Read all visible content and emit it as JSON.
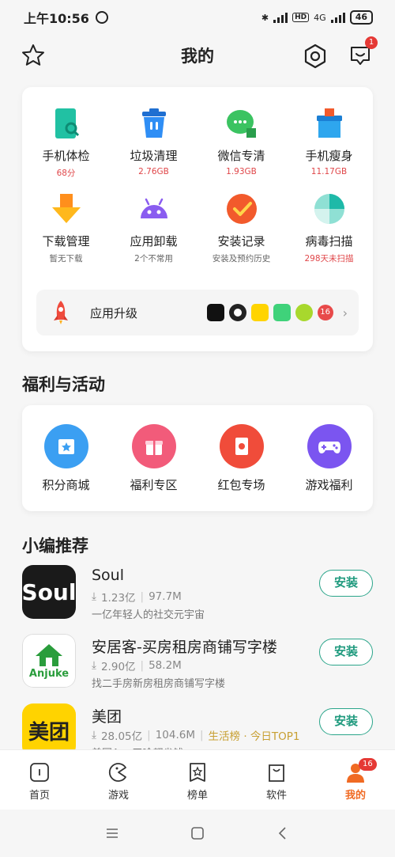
{
  "status_bar": {
    "time": "上午10:56",
    "network": "4G",
    "battery": "46"
  },
  "header": {
    "title": "我的",
    "msg_badge": "1"
  },
  "tools": [
    {
      "label": "手机体检",
      "sub": "68分",
      "sub_style": "red",
      "icon": "phone-scan-icon",
      "color": "#21c1a3"
    },
    {
      "label": "垃圾清理",
      "sub": "2.76GB",
      "sub_style": "red",
      "icon": "trash-icon",
      "color": "#2f8ef5"
    },
    {
      "label": "微信专清",
      "sub": "1.93GB",
      "sub_style": "red",
      "icon": "wechat-clean-icon",
      "color": "#3bc361"
    },
    {
      "label": "手机瘦身",
      "sub": "11.17GB",
      "sub_style": "red",
      "icon": "slim-box-icon",
      "color": "#2ea6ee"
    },
    {
      "label": "下载管理",
      "sub": "暂无下载",
      "sub_style": "gray",
      "icon": "download-arrow-icon",
      "color": "#ffb81c"
    },
    {
      "label": "应用卸载",
      "sub": "2个不常用",
      "sub_style": "gray",
      "icon": "android-icon",
      "color": "#8a5cf0"
    },
    {
      "label": "安装记录",
      "sub": "安装及预约历史",
      "sub_style": "gray",
      "icon": "check-circle-icon",
      "color": "#f25a2c"
    },
    {
      "label": "病毒扫描",
      "sub": "298天未扫描",
      "sub_style": "red",
      "icon": "virus-scan-icon",
      "color": "#1eb9a8"
    }
  ],
  "upgrade": {
    "label": "应用升级",
    "count": "16",
    "app_icons": [
      "tiktok-icon",
      "qq-icon",
      "xianyu-icon",
      "video-icon",
      "browser-icon"
    ]
  },
  "welfare": {
    "title": "福利与活动",
    "items": [
      {
        "label": "积分商城",
        "icon": "points-mall-icon",
        "color": "#3b9ff2"
      },
      {
        "label": "福利专区",
        "icon": "gift-icon",
        "color": "#f25b7a"
      },
      {
        "label": "红包专场",
        "icon": "red-packet-icon",
        "color": "#f04c3a"
      },
      {
        "label": "游戏福利",
        "icon": "gamepad-icon",
        "color": "#7b55f0"
      }
    ]
  },
  "recommend": {
    "title": "小编推荐",
    "apps": [
      {
        "name": "Soul",
        "downloads": "1.23亿",
        "size": "97.7M",
        "rank": "",
        "desc": "一亿年轻人的社交元宇宙",
        "install": "安装",
        "logo_text": "Soul"
      },
      {
        "name": "安居客-买房租房商铺写字楼",
        "downloads": "2.90亿",
        "size": "58.2M",
        "rank": "",
        "desc": "找二手房新房租房商铺写字楼",
        "install": "安装",
        "logo_text": "Anjuke"
      },
      {
        "name": "美团",
        "downloads": "28.05亿",
        "size": "104.6M",
        "rank": "生活榜 · 今日TOP1",
        "desc": "美团App干啥都省钱",
        "install": "安装",
        "logo_text": "美团"
      }
    ]
  },
  "tabbar": {
    "tabs": [
      {
        "label": "首页",
        "icon": "home-icon"
      },
      {
        "label": "游戏",
        "icon": "game-icon"
      },
      {
        "label": "榜单",
        "icon": "ranking-icon"
      },
      {
        "label": "软件",
        "icon": "software-bag-icon"
      },
      {
        "label": "我的",
        "icon": "profile-icon",
        "badge": "16"
      }
    ]
  },
  "colors": {
    "accent": "#f06a23",
    "install_green": "#1f9a7e",
    "red_text": "#e0474a"
  }
}
